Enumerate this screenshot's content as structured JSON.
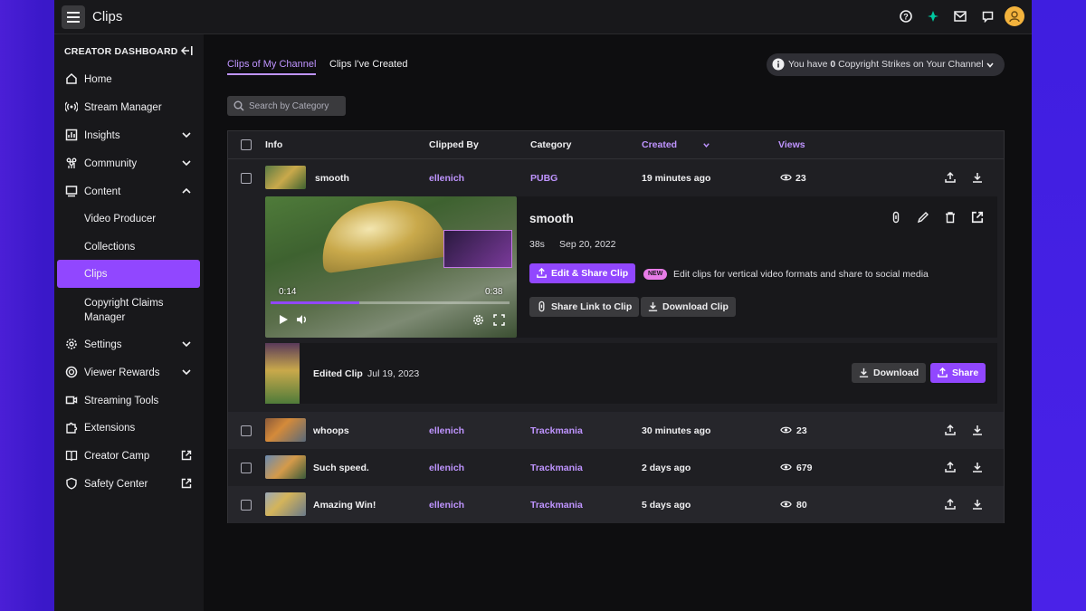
{
  "app": {
    "title": "Clips"
  },
  "topbar": {
    "icons": [
      "help-icon",
      "crown-icon",
      "inbox-icon",
      "whispers-icon",
      "avatar"
    ]
  },
  "sidebar": {
    "header": "CREATOR DASHBOARD",
    "items": [
      {
        "label": "Home",
        "icon": "home-icon"
      },
      {
        "label": "Stream Manager",
        "icon": "broadcast-icon"
      },
      {
        "label": "Insights",
        "icon": "insights-icon",
        "expandable": true
      },
      {
        "label": "Community",
        "icon": "community-icon",
        "expandable": true
      },
      {
        "label": "Content",
        "icon": "content-icon",
        "expanded": true
      },
      {
        "label": "Video Producer",
        "sub": true
      },
      {
        "label": "Collections",
        "sub": true
      },
      {
        "label": "Clips",
        "sub": true,
        "active": true
      },
      {
        "label": "Copyright Claims Manager",
        "sub": true
      },
      {
        "label": "Settings",
        "icon": "gear-icon",
        "expandable": true
      },
      {
        "label": "Viewer Rewards",
        "icon": "rewards-icon",
        "expandable": true
      },
      {
        "label": "Streaming Tools",
        "icon": "camera-icon"
      },
      {
        "label": "Extensions",
        "icon": "puzzle-icon"
      },
      {
        "label": "Creator Camp",
        "icon": "book-icon",
        "external": true
      },
      {
        "label": "Safety Center",
        "icon": "shield-icon",
        "external": true
      }
    ]
  },
  "tabs": [
    {
      "label": "Clips of My Channel",
      "active": true
    },
    {
      "label": "Clips I've Created",
      "active": false
    }
  ],
  "strikes": {
    "prefix": "You have ",
    "count": "0",
    "suffix": " Copyright Strikes on Your Channel"
  },
  "search": {
    "placeholder": "Search by Category"
  },
  "table": {
    "headers": {
      "info": "Info",
      "clipped_by": "Clipped By",
      "category": "Category",
      "created": "Created",
      "views": "Views"
    },
    "rows": [
      {
        "title": "smooth",
        "clipped_by": "ellenich",
        "category": "PUBG",
        "created": "19 minutes ago",
        "views": "23"
      },
      {
        "title": "whoops",
        "clipped_by": "ellenich",
        "category": "Trackmania",
        "created": "30 minutes ago",
        "views": "23"
      },
      {
        "title": "Such speed.",
        "clipped_by": "ellenich",
        "category": "Trackmania",
        "created": "2 days ago",
        "views": "679"
      },
      {
        "title": "Amazing Win!",
        "clipped_by": "ellenich",
        "category": "Trackmania",
        "created": "5 days ago",
        "views": "80"
      }
    ]
  },
  "expanded": {
    "title": "smooth",
    "duration": "38s",
    "date": "Sep 20, 2022",
    "video": {
      "current": "0:14",
      "total": "0:38",
      "progress": 0.37
    },
    "edit_share_label": "Edit & Share Clip",
    "new_badge": "NEW",
    "new_text": "Edit clips for vertical video formats and share to social media",
    "share_link_label": "Share Link to Clip",
    "download_clip_label": "Download Clip",
    "edited": {
      "label": "Edited Clip",
      "date": "Jul 19, 2023",
      "download_label": "Download",
      "share_label": "Share"
    }
  }
}
